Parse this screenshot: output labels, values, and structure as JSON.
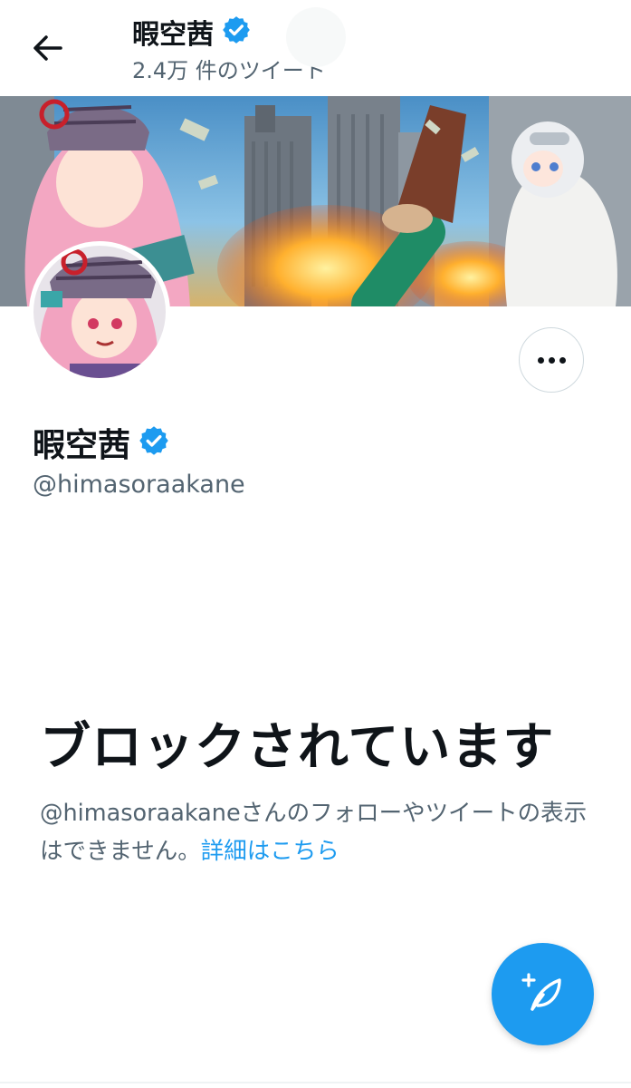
{
  "header": {
    "title": "暇空茜",
    "tweet_count": "2.4万 件のツイート",
    "back_icon": "arrow-left-icon",
    "verified_icon": "verified-badge-icon"
  },
  "profile": {
    "display_name": "暇空茜",
    "handle": "@himasoraakane",
    "more_icon": "more-horizontal-icon"
  },
  "blocked": {
    "title": "ブロックされています",
    "description": "@himasoraakaneさんのフォローやツイートの表示はできません。",
    "link_text": "詳細はこちら"
  },
  "fab": {
    "icon": "compose-tweet-icon"
  },
  "colors": {
    "accent": "#1d9bf0",
    "text_primary": "#0f1419",
    "text_secondary": "#536471",
    "border": "#cfd9de"
  }
}
